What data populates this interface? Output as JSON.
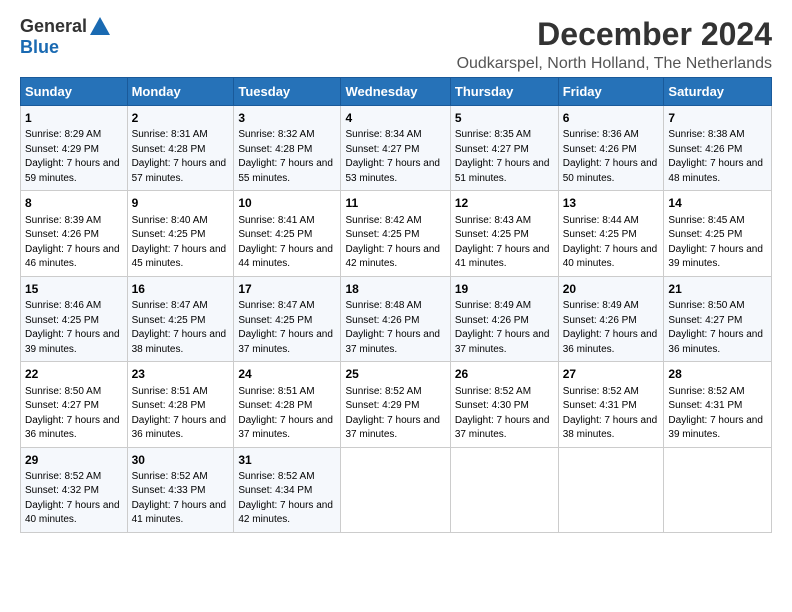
{
  "logo": {
    "general": "General",
    "blue": "Blue"
  },
  "title": "December 2024",
  "subtitle": "Oudkarspel, North Holland, The Netherlands",
  "columns": [
    "Sunday",
    "Monday",
    "Tuesday",
    "Wednesday",
    "Thursday",
    "Friday",
    "Saturday"
  ],
  "weeks": [
    [
      {
        "day": "1",
        "sunrise": "Sunrise: 8:29 AM",
        "sunset": "Sunset: 4:29 PM",
        "daylight": "Daylight: 7 hours and 59 minutes."
      },
      {
        "day": "2",
        "sunrise": "Sunrise: 8:31 AM",
        "sunset": "Sunset: 4:28 PM",
        "daylight": "Daylight: 7 hours and 57 minutes."
      },
      {
        "day": "3",
        "sunrise": "Sunrise: 8:32 AM",
        "sunset": "Sunset: 4:28 PM",
        "daylight": "Daylight: 7 hours and 55 minutes."
      },
      {
        "day": "4",
        "sunrise": "Sunrise: 8:34 AM",
        "sunset": "Sunset: 4:27 PM",
        "daylight": "Daylight: 7 hours and 53 minutes."
      },
      {
        "day": "5",
        "sunrise": "Sunrise: 8:35 AM",
        "sunset": "Sunset: 4:27 PM",
        "daylight": "Daylight: 7 hours and 51 minutes."
      },
      {
        "day": "6",
        "sunrise": "Sunrise: 8:36 AM",
        "sunset": "Sunset: 4:26 PM",
        "daylight": "Daylight: 7 hours and 50 minutes."
      },
      {
        "day": "7",
        "sunrise": "Sunrise: 8:38 AM",
        "sunset": "Sunset: 4:26 PM",
        "daylight": "Daylight: 7 hours and 48 minutes."
      }
    ],
    [
      {
        "day": "8",
        "sunrise": "Sunrise: 8:39 AM",
        "sunset": "Sunset: 4:26 PM",
        "daylight": "Daylight: 7 hours and 46 minutes."
      },
      {
        "day": "9",
        "sunrise": "Sunrise: 8:40 AM",
        "sunset": "Sunset: 4:25 PM",
        "daylight": "Daylight: 7 hours and 45 minutes."
      },
      {
        "day": "10",
        "sunrise": "Sunrise: 8:41 AM",
        "sunset": "Sunset: 4:25 PM",
        "daylight": "Daylight: 7 hours and 44 minutes."
      },
      {
        "day": "11",
        "sunrise": "Sunrise: 8:42 AM",
        "sunset": "Sunset: 4:25 PM",
        "daylight": "Daylight: 7 hours and 42 minutes."
      },
      {
        "day": "12",
        "sunrise": "Sunrise: 8:43 AM",
        "sunset": "Sunset: 4:25 PM",
        "daylight": "Daylight: 7 hours and 41 minutes."
      },
      {
        "day": "13",
        "sunrise": "Sunrise: 8:44 AM",
        "sunset": "Sunset: 4:25 PM",
        "daylight": "Daylight: 7 hours and 40 minutes."
      },
      {
        "day": "14",
        "sunrise": "Sunrise: 8:45 AM",
        "sunset": "Sunset: 4:25 PM",
        "daylight": "Daylight: 7 hours and 39 minutes."
      }
    ],
    [
      {
        "day": "15",
        "sunrise": "Sunrise: 8:46 AM",
        "sunset": "Sunset: 4:25 PM",
        "daylight": "Daylight: 7 hours and 39 minutes."
      },
      {
        "day": "16",
        "sunrise": "Sunrise: 8:47 AM",
        "sunset": "Sunset: 4:25 PM",
        "daylight": "Daylight: 7 hours and 38 minutes."
      },
      {
        "day": "17",
        "sunrise": "Sunrise: 8:47 AM",
        "sunset": "Sunset: 4:25 PM",
        "daylight": "Daylight: 7 hours and 37 minutes."
      },
      {
        "day": "18",
        "sunrise": "Sunrise: 8:48 AM",
        "sunset": "Sunset: 4:26 PM",
        "daylight": "Daylight: 7 hours and 37 minutes."
      },
      {
        "day": "19",
        "sunrise": "Sunrise: 8:49 AM",
        "sunset": "Sunset: 4:26 PM",
        "daylight": "Daylight: 7 hours and 37 minutes."
      },
      {
        "day": "20",
        "sunrise": "Sunrise: 8:49 AM",
        "sunset": "Sunset: 4:26 PM",
        "daylight": "Daylight: 7 hours and 36 minutes."
      },
      {
        "day": "21",
        "sunrise": "Sunrise: 8:50 AM",
        "sunset": "Sunset: 4:27 PM",
        "daylight": "Daylight: 7 hours and 36 minutes."
      }
    ],
    [
      {
        "day": "22",
        "sunrise": "Sunrise: 8:50 AM",
        "sunset": "Sunset: 4:27 PM",
        "daylight": "Daylight: 7 hours and 36 minutes."
      },
      {
        "day": "23",
        "sunrise": "Sunrise: 8:51 AM",
        "sunset": "Sunset: 4:28 PM",
        "daylight": "Daylight: 7 hours and 36 minutes."
      },
      {
        "day": "24",
        "sunrise": "Sunrise: 8:51 AM",
        "sunset": "Sunset: 4:28 PM",
        "daylight": "Daylight: 7 hours and 37 minutes."
      },
      {
        "day": "25",
        "sunrise": "Sunrise: 8:52 AM",
        "sunset": "Sunset: 4:29 PM",
        "daylight": "Daylight: 7 hours and 37 minutes."
      },
      {
        "day": "26",
        "sunrise": "Sunrise: 8:52 AM",
        "sunset": "Sunset: 4:30 PM",
        "daylight": "Daylight: 7 hours and 37 minutes."
      },
      {
        "day": "27",
        "sunrise": "Sunrise: 8:52 AM",
        "sunset": "Sunset: 4:31 PM",
        "daylight": "Daylight: 7 hours and 38 minutes."
      },
      {
        "day": "28",
        "sunrise": "Sunrise: 8:52 AM",
        "sunset": "Sunset: 4:31 PM",
        "daylight": "Daylight: 7 hours and 39 minutes."
      }
    ],
    [
      {
        "day": "29",
        "sunrise": "Sunrise: 8:52 AM",
        "sunset": "Sunset: 4:32 PM",
        "daylight": "Daylight: 7 hours and 40 minutes."
      },
      {
        "day": "30",
        "sunrise": "Sunrise: 8:52 AM",
        "sunset": "Sunset: 4:33 PM",
        "daylight": "Daylight: 7 hours and 41 minutes."
      },
      {
        "day": "31",
        "sunrise": "Sunrise: 8:52 AM",
        "sunset": "Sunset: 4:34 PM",
        "daylight": "Daylight: 7 hours and 42 minutes."
      },
      null,
      null,
      null,
      null
    ]
  ]
}
